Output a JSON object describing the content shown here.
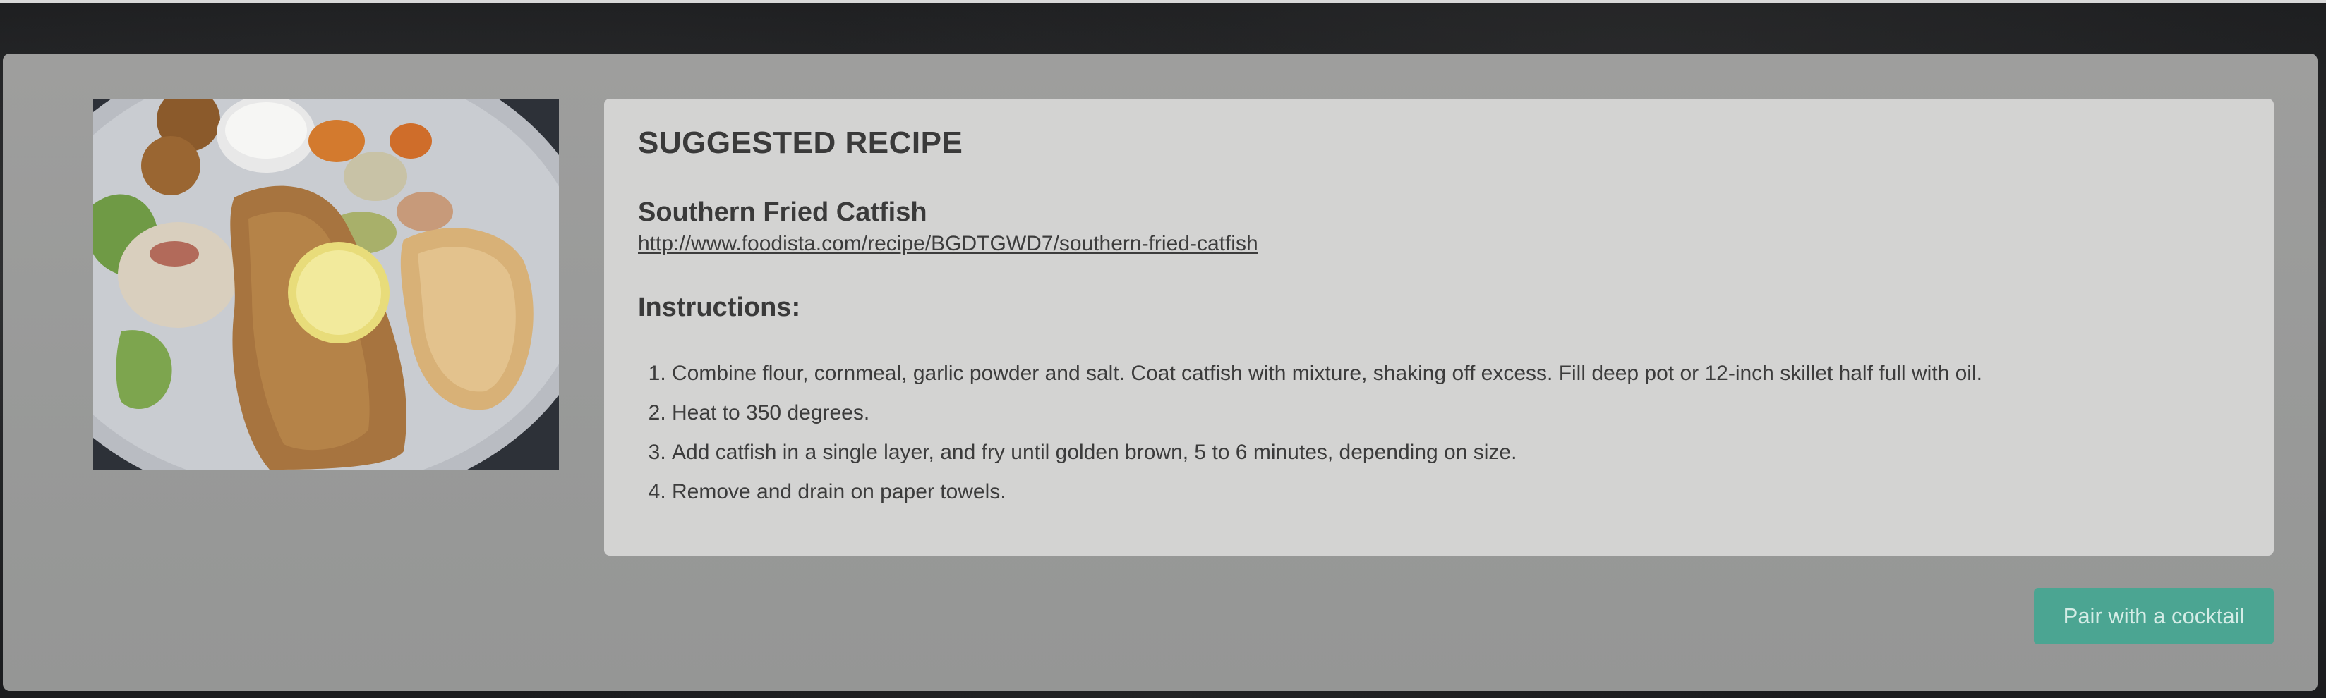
{
  "recipe_card": {
    "heading": "SUGGESTED RECIPE",
    "name": "Southern Fried Catfish",
    "url": "http://www.foodista.com/recipe/BGDTGWD7/southern-fried-catfish",
    "instructions_heading": "Instructions:",
    "steps": [
      "Combine flour, cornmeal, garlic powder and salt. Coat catfish with mixture, shaking off excess. Fill deep pot or 12-inch skillet half full with oil.",
      "Heat to 350 degrees.",
      "Add catfish in a single layer, and fry until golden brown, 5 to 6 minutes, depending on size.",
      "Remove and drain on paper towels."
    ]
  },
  "actions": {
    "pair_button_label": "Pair with a cocktail"
  },
  "colors": {
    "accent": "#4ba592",
    "panel": "#9a9b9a",
    "card": "#d3d3d2"
  }
}
